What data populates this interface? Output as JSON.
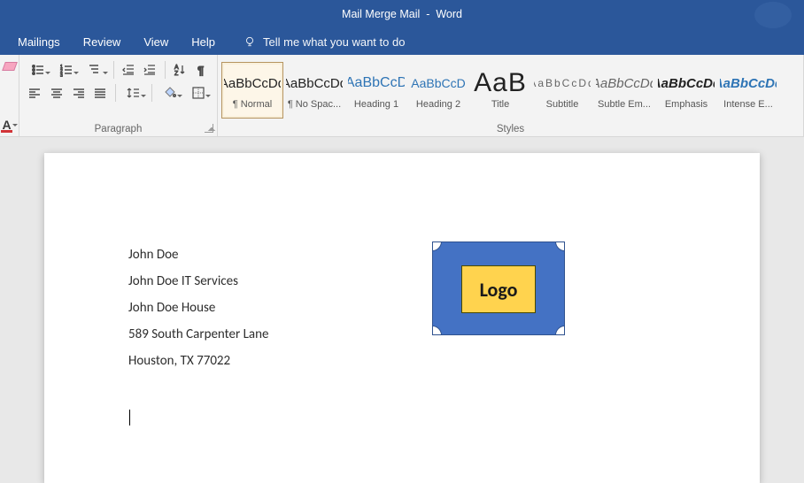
{
  "titlebar": {
    "document_name": "Mail Merge Mail",
    "separator": "  -  ",
    "app_name": "Word"
  },
  "menu": {
    "items": [
      "Mailings",
      "Review",
      "View",
      "Help"
    ],
    "tellme_placeholder": "Tell me what you want to do"
  },
  "ribbon": {
    "paragraph_label": "Paragraph",
    "styles_label": "Styles",
    "styles": [
      {
        "sample": "AaBbCcDd",
        "name": "¶ Normal",
        "selected": true,
        "cls": "s-normal"
      },
      {
        "sample": "AaBbCcDd",
        "name": "¶ No Spac...",
        "selected": false,
        "cls": "s-nospace"
      },
      {
        "sample": "AaBbCcD",
        "name": "Heading 1",
        "selected": false,
        "cls": "s-h1"
      },
      {
        "sample": "AaBbCcD",
        "name": "Heading 2",
        "selected": false,
        "cls": "s-h2"
      },
      {
        "sample": "AaB",
        "name": "Title",
        "selected": false,
        "cls": "s-title"
      },
      {
        "sample": "AaBbCcDd",
        "name": "Subtitle",
        "selected": false,
        "cls": "s-subtitle"
      },
      {
        "sample": "AaBbCcDd",
        "name": "Subtle Em...",
        "selected": false,
        "cls": "s-subtleem"
      },
      {
        "sample": "AaBbCcDd",
        "name": "Emphasis",
        "selected": false,
        "cls": "s-emphasis"
      },
      {
        "sample": "AaBbCcDd",
        "name": "Intense E...",
        "selected": false,
        "cls": "s-intense"
      }
    ]
  },
  "document": {
    "lines": [
      "John Doe",
      "John Doe IT Services",
      "John Doe House",
      "589 South Carpenter Lane",
      "Houston, TX 77022"
    ],
    "logo_text": "Logo"
  }
}
